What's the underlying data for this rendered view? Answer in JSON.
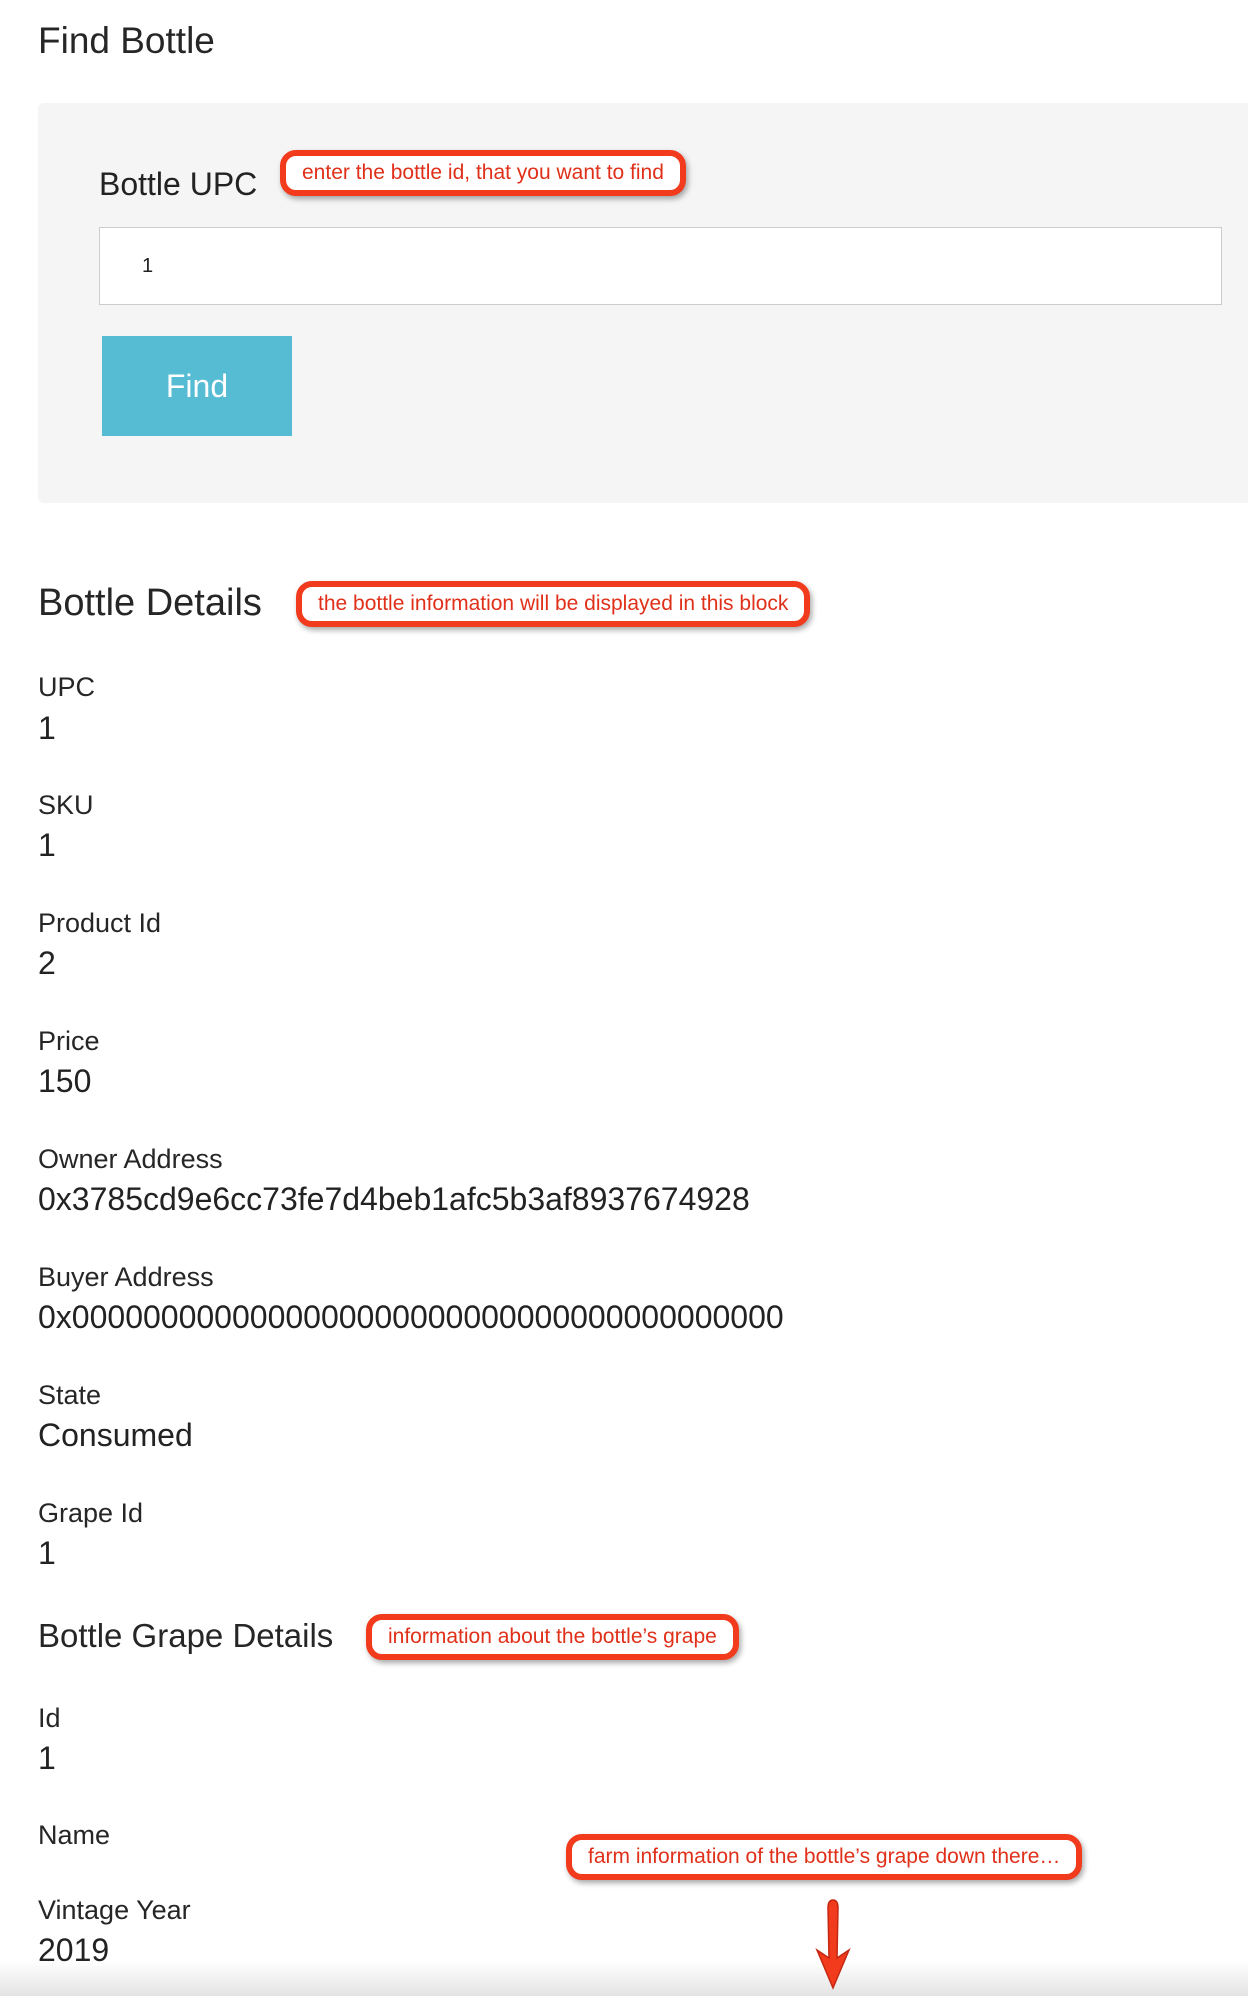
{
  "find": {
    "title": "Find Bottle",
    "upc_label": "Bottle UPC",
    "upc_value": "1",
    "button_label": "Find"
  },
  "details": {
    "title": "Bottle Details",
    "fields": [
      {
        "label": "UPC",
        "value": "1"
      },
      {
        "label": "SKU",
        "value": "1"
      },
      {
        "label": "Product Id",
        "value": "2"
      },
      {
        "label": "Price",
        "value": "150"
      },
      {
        "label": "Owner Address",
        "value": "0x3785cd9e6cc73fe7d4beb1afc5b3af8937674928"
      },
      {
        "label": "Buyer Address",
        "value": "0x0000000000000000000000000000000000000000"
      },
      {
        "label": "State",
        "value": "Consumed"
      },
      {
        "label": "Grape Id",
        "value": "1"
      }
    ]
  },
  "grape": {
    "title": "Bottle Grape Details",
    "fields": [
      {
        "label": "Id",
        "value": "1"
      },
      {
        "label": "Name",
        "value": ""
      },
      {
        "label": "Vintage Year",
        "value": "2019"
      }
    ]
  },
  "annotations": {
    "find": "enter the bottle id, that you want to find",
    "details": "the bottle information will be displayed in this block",
    "grape": "information about the bottle’s grape",
    "farm": "farm information of the bottle’s grape down there…"
  },
  "colors": {
    "button": "#56bcd3",
    "callout": "#f23a1d",
    "panel": "#f5f5f5"
  }
}
